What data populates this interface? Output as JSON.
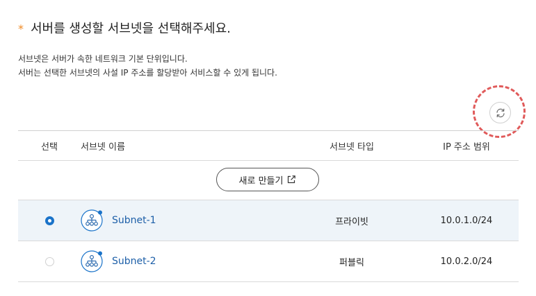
{
  "title": {
    "star": "*",
    "text": "서버를 생성할 서브넷을 선택해주세요."
  },
  "description": {
    "line1": "서브넷은 서버가 속한 네트워크 기본 단위입니다.",
    "line2": "서버는 선택한 서브넷의 사설 IP 주소를 할당받아 서비스할 수 있게 됩니다."
  },
  "table": {
    "headers": {
      "select": "선택",
      "name": "서브넷 이름",
      "type": "서브넷 타입",
      "ip_range": "IP 주소 범위"
    },
    "create_button_label": "새로 만들기",
    "rows": [
      {
        "selected": true,
        "name": "Subnet-1",
        "type": "프라이빗",
        "ip_range": "10.0.1.0/24"
      },
      {
        "selected": false,
        "name": "Subnet-2",
        "type": "퍼블릭",
        "ip_range": "10.0.2.0/24"
      }
    ]
  },
  "colors": {
    "accent": "#1a73c9",
    "link": "#1d5fa8",
    "required_star": "#f08a24",
    "highlight_circle": "#e05a5a",
    "selected_row_bg": "#eef4f9"
  },
  "icons": {
    "refresh": "refresh-icon",
    "external_link": "external-link-icon",
    "subnet": "subnet-network-icon"
  }
}
